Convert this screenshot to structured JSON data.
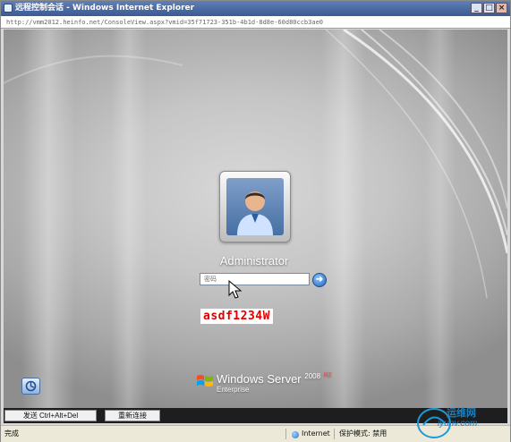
{
  "window": {
    "title": "远程控制会话 - Windows Internet Explorer",
    "url": "http://vmm2012.heinfo.net/ConsoleView.aspx?vmid=35f71723-351b-4b1d-8d8e-60d80ccb3ae0"
  },
  "logon": {
    "username": "Administrator",
    "password_placeholder": "密码",
    "user_icon": "user-avatar-icon",
    "go_icon": "arrow-right-icon"
  },
  "annotation": {
    "text": "asdf1234W",
    "color": "#e00000"
  },
  "branding": {
    "product": "Windows Server",
    "version": "2008",
    "version_suffix": "R2",
    "edition": "Enterprise"
  },
  "toolbar": {
    "cad_button": "发送 Ctrl+Alt+Del",
    "reconnect_button": "重新连接"
  },
  "statusbar": {
    "status": "完成",
    "zone": "Internet",
    "protected_mode": "保护模式: 禁用"
  },
  "watermark": {
    "brand": "运维网",
    "url": "iyunv.com"
  }
}
